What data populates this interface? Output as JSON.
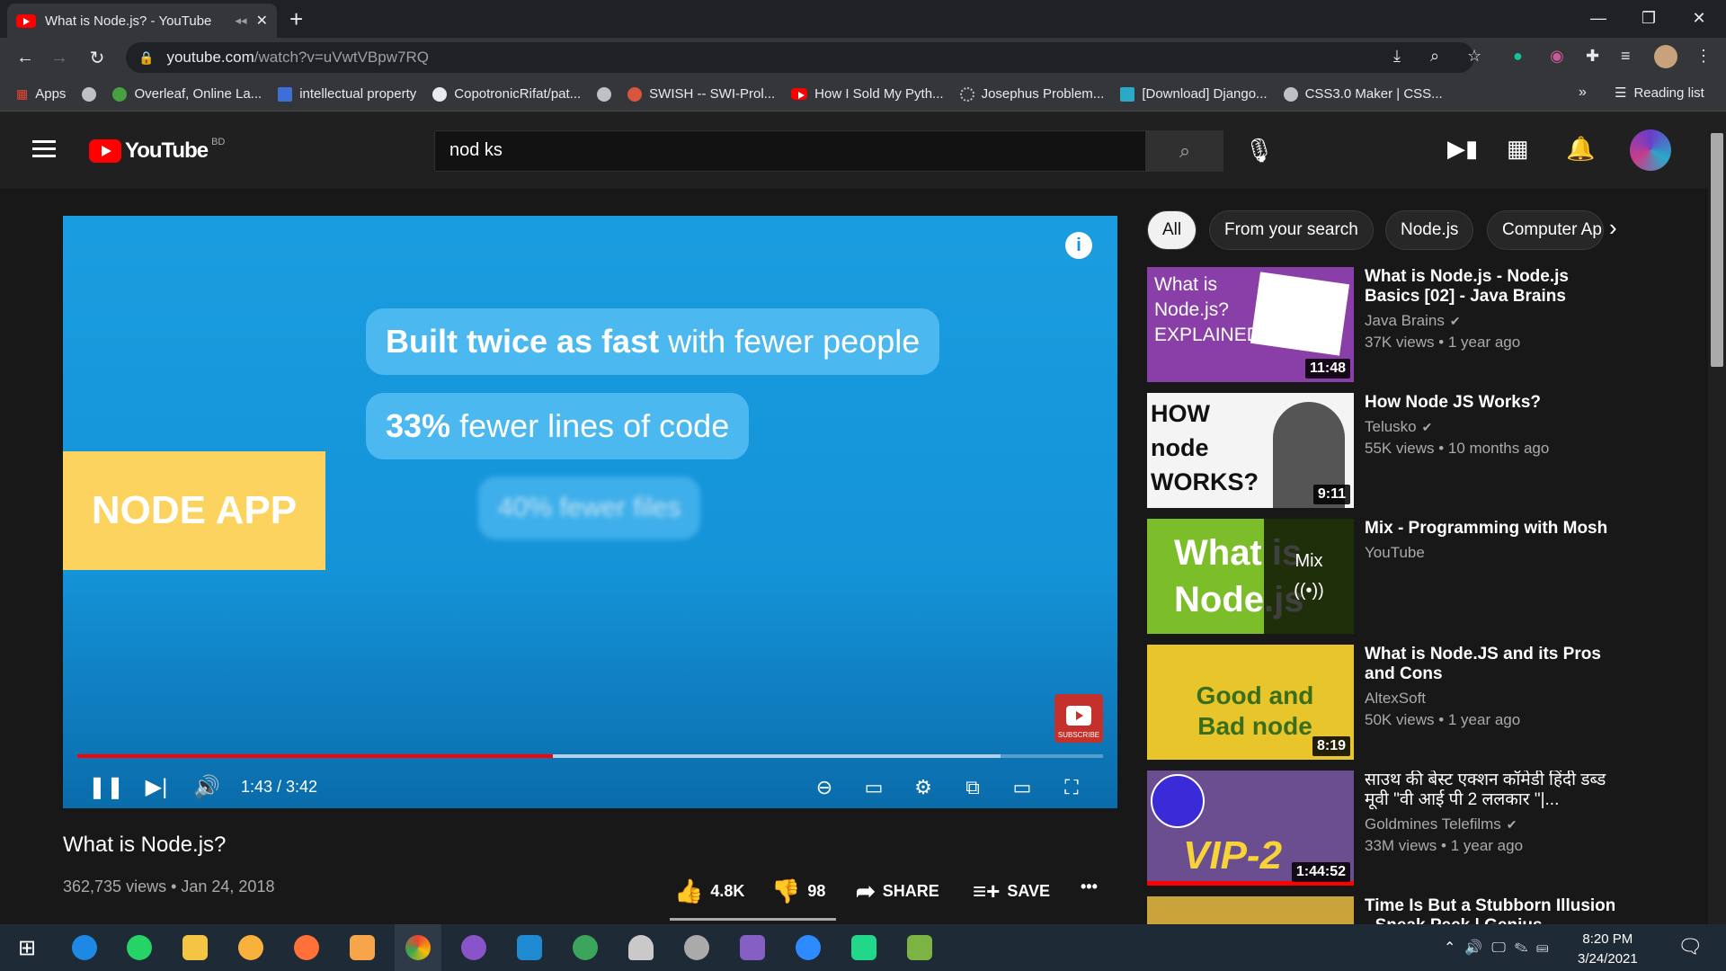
{
  "browser": {
    "tab_title": "What is Node.js? - YouTube",
    "new_tab": "+",
    "url_host": "youtube.com",
    "url_path": "/watch?v=uVwtVBpw7RQ",
    "reading_list": "Reading list"
  },
  "bookmarks": [
    {
      "label": "Apps"
    },
    {
      "label": ""
    },
    {
      "label": "Overleaf, Online La..."
    },
    {
      "label": "intellectual property"
    },
    {
      "label": "CopotronicRifat/pat..."
    },
    {
      "label": ""
    },
    {
      "label": "SWISH -- SWI-Prol..."
    },
    {
      "label": "How I Sold My Pyth..."
    },
    {
      "label": "Josephus Problem..."
    },
    {
      "label": "[Download] Django..."
    },
    {
      "label": "CSS3.0 Maker | CSS..."
    }
  ],
  "youtube": {
    "logo": "YouTube",
    "country": "BD",
    "search_value": "nod ks"
  },
  "player": {
    "slide": {
      "line1_bold": "Built twice as fast",
      "line1_rest": "with fewer people",
      "line2_bold": "33%",
      "line2_rest": "fewer lines of code",
      "line3": "40% fewer files",
      "node_app": "NODE APP"
    },
    "info": "i",
    "subscribe": "SUBSCRIBE",
    "time": "1:43 / 3:42",
    "played_fraction": 0.464,
    "buffered_fraction": 0.9
  },
  "video": {
    "title": "What is Node.js?",
    "meta": "362,735 views • Jan 24, 2018",
    "likes": "4.8K",
    "dislikes": "98",
    "share": "SHARE",
    "save": "SAVE",
    "more": "•••"
  },
  "chips": [
    "All",
    "From your search",
    "Node.js",
    "Computer Ap"
  ],
  "recommendations": [
    {
      "title": "What is Node.js - Node.js Basics [02] - Java Brains",
      "channel": "Java Brains",
      "verified": true,
      "meta": "37K views • 1 year ago",
      "duration": "11:48",
      "thumb_text": "What is Node.js? EXPLAINED!"
    },
    {
      "title": "How Node JS Works?",
      "channel": "Telusko",
      "verified": true,
      "meta": "55K views • 10 months ago",
      "duration": "9:11",
      "thumb_text": "HOW node WORKS?"
    },
    {
      "title": "Mix - Programming with Mosh",
      "channel": "YouTube",
      "verified": false,
      "meta": "",
      "duration": "",
      "thumb_text": "What is Node.js",
      "mix_label": "Mix"
    },
    {
      "title": "What is Node.JS and its Pros and Cons",
      "channel": "AltexSoft",
      "verified": false,
      "meta": "50K views • 1 year ago",
      "duration": "8:19",
      "thumb_text": "Good and Bad node"
    },
    {
      "title": "साउथ की बेस्ट एक्शन कॉमेडी हिंदी डब्ड मूवी \"वी आई पी 2 ललकार \"|...",
      "channel": "Goldmines Telefilms",
      "verified": true,
      "meta": "33M views • 1 year ago",
      "duration": "1:44:52",
      "thumb_text": "VIP-2"
    },
    {
      "title": "Time Is But a Stubborn Illusion - Sneak Peek | Genius",
      "channel": "",
      "verified": false,
      "meta": "",
      "duration": "",
      "thumb_text": ""
    }
  ],
  "taskbar": {
    "time": "8:20 PM",
    "date": "3/24/2021"
  },
  "colors": {
    "yt_red": "#ff0000",
    "player_blue": "#1593d8",
    "bubble_blue": "#4cb8f0",
    "node_yellow": "#fbd35e"
  }
}
